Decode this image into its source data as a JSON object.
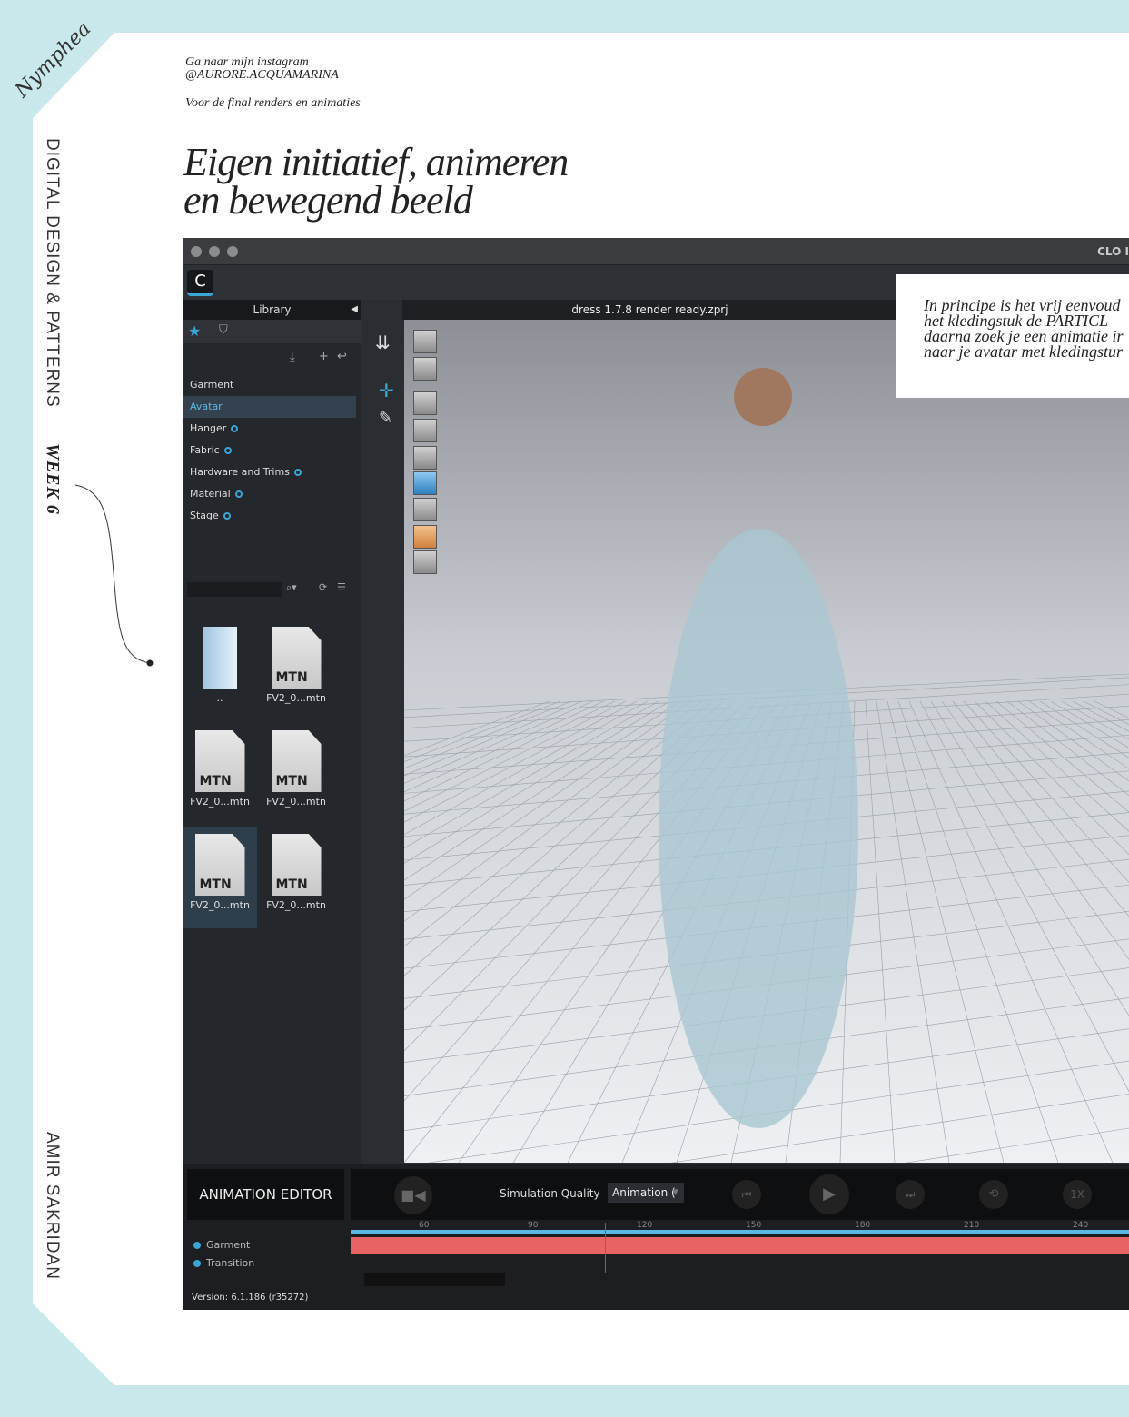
{
  "page": {
    "logo": "Nymphea",
    "instagram_line1": "Ga naar mijn instagram",
    "instagram_line2": "@AURORE.ACQUAMARINA",
    "subnote": "Voor de final renders en animaties",
    "title_line1": "Eigen initiatief, animeren",
    "title_line2": "en bewegend beeld",
    "side_top": "DIGITAL DESIGN & PATTERNS",
    "side_week": "WEEK 6",
    "side_bottom": "AMIR SAKRIDAN",
    "callout": [
      "In principe is het vrij eenvoud",
      "het kledingstuk de PARTICL",
      "daarna zoek je een animatie ir",
      "naar je avatar met kledingstur"
    ]
  },
  "app": {
    "title": "CLO I",
    "file_title": "dress 1.7.8 render ready.zprj",
    "library": {
      "title": "Library",
      "items": [
        {
          "label": "Garment",
          "new": false
        },
        {
          "label": "Avatar",
          "new": false,
          "selected": true
        },
        {
          "label": "Hanger",
          "new": true
        },
        {
          "label": "Fabric",
          "new": true
        },
        {
          "label": "Hardware and Trims",
          "new": true
        },
        {
          "label": "Material",
          "new": true
        },
        {
          "label": "Stage",
          "new": true
        }
      ],
      "files": [
        {
          "label": ".."
        },
        {
          "label": "FV2_0...mtn",
          "badge": "MTN"
        },
        {
          "label": "FV2_0...mtn",
          "badge": "MTN"
        },
        {
          "label": "FV2_0...mtn",
          "badge": "MTN"
        },
        {
          "label": "FV2_0...mtn",
          "badge": "MTN",
          "selected": true
        },
        {
          "label": "FV2_0...mtn",
          "badge": "MTN"
        }
      ]
    },
    "animation": {
      "title": "ANIMATION EDITOR",
      "sim_label": "Simulation Quality",
      "sim_value": "Animation (",
      "speed": "1X",
      "ticks": [
        "60",
        "90",
        "120",
        "150",
        "180",
        "210",
        "240"
      ],
      "current_frame": 110,
      "tracks": [
        "Garment",
        "Transition"
      ],
      "version": "Version: 6.1.186 (r35272)"
    }
  },
  "colors": {
    "background": "#c9e8ec",
    "accent": "#3aa6d6",
    "track": "#e86464"
  }
}
